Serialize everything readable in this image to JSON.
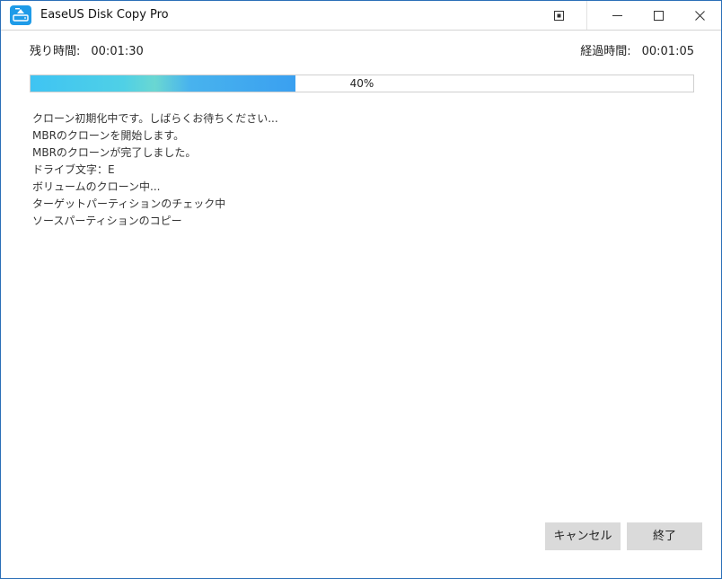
{
  "window": {
    "title": "EaseUS Disk Copy Pro",
    "icon": "easeus-disk-copy-app-icon",
    "controls": [
      "pin-restore-icon",
      "minimize-icon",
      "maximize-icon",
      "close-icon"
    ]
  },
  "times": {
    "remaining_label": "残り時間:",
    "remaining_value": "00:01:30",
    "elapsed_label": "経過時間:",
    "elapsed_value": "00:01:05"
  },
  "progress": {
    "percent": 40,
    "label": "40%"
  },
  "log": [
    "クローン初期化中です。しばらくお待ちください...",
    "MBRのクローンを開始します。",
    "MBRのクローンが完了しました。",
    "ドライブ文字：E",
    "ボリュームのクローン中...",
    "ターゲットパーティションのチェック中",
    "ソースパーティションのコピー"
  ],
  "buttons": {
    "cancel": "キャンセル",
    "finish": "終了"
  },
  "colors": {
    "window_border": "#2b6fb8",
    "progress_start": "#3fc4f3",
    "progress_end": "#3aa0f0",
    "button_bg": "#dadada"
  }
}
